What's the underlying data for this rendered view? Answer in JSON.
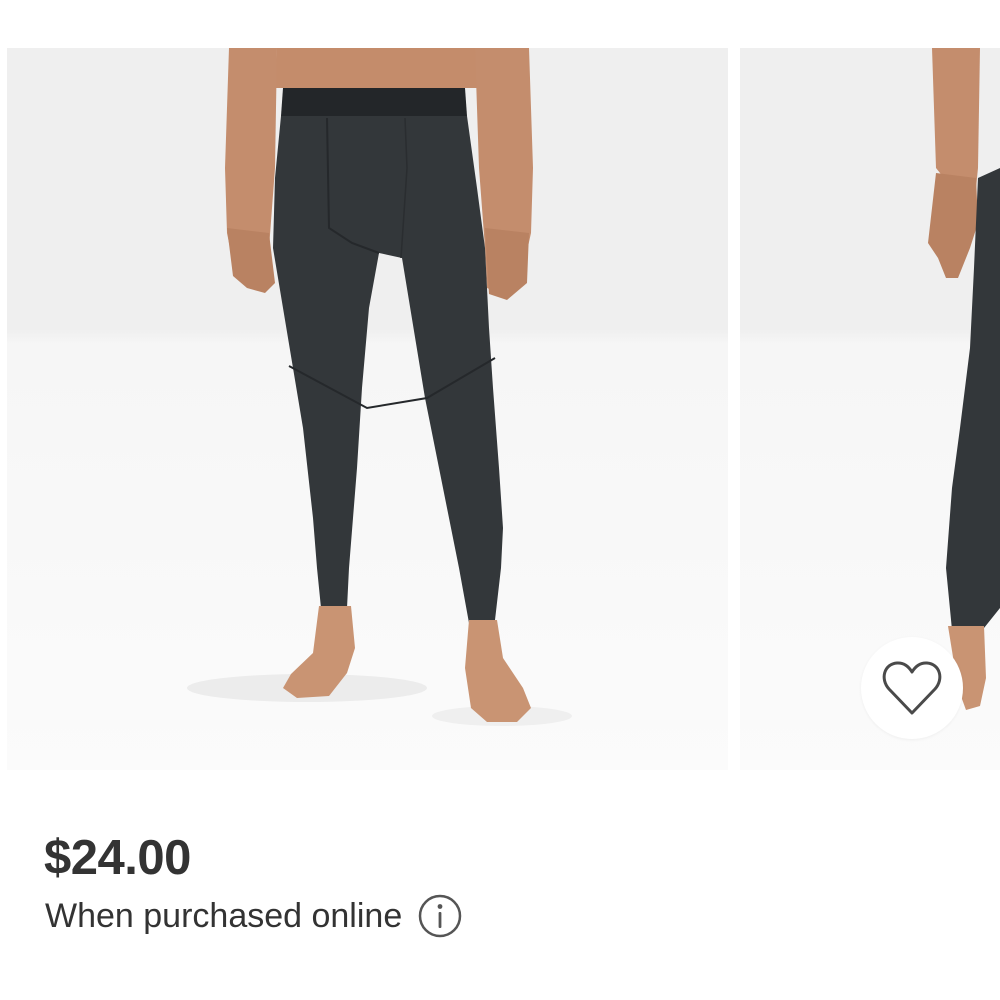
{
  "product": {
    "price": "$24.00",
    "price_note": "When purchased online",
    "main_image_icon": "product-photo-model-front",
    "side_image_icon": "product-photo-model-side"
  },
  "favorite": {
    "icon": "heart-outline-icon"
  },
  "info": {
    "icon": "info-circle-icon"
  },
  "colors": {
    "garment": "#33373a",
    "skin": "#c99473",
    "text": "#333333"
  }
}
